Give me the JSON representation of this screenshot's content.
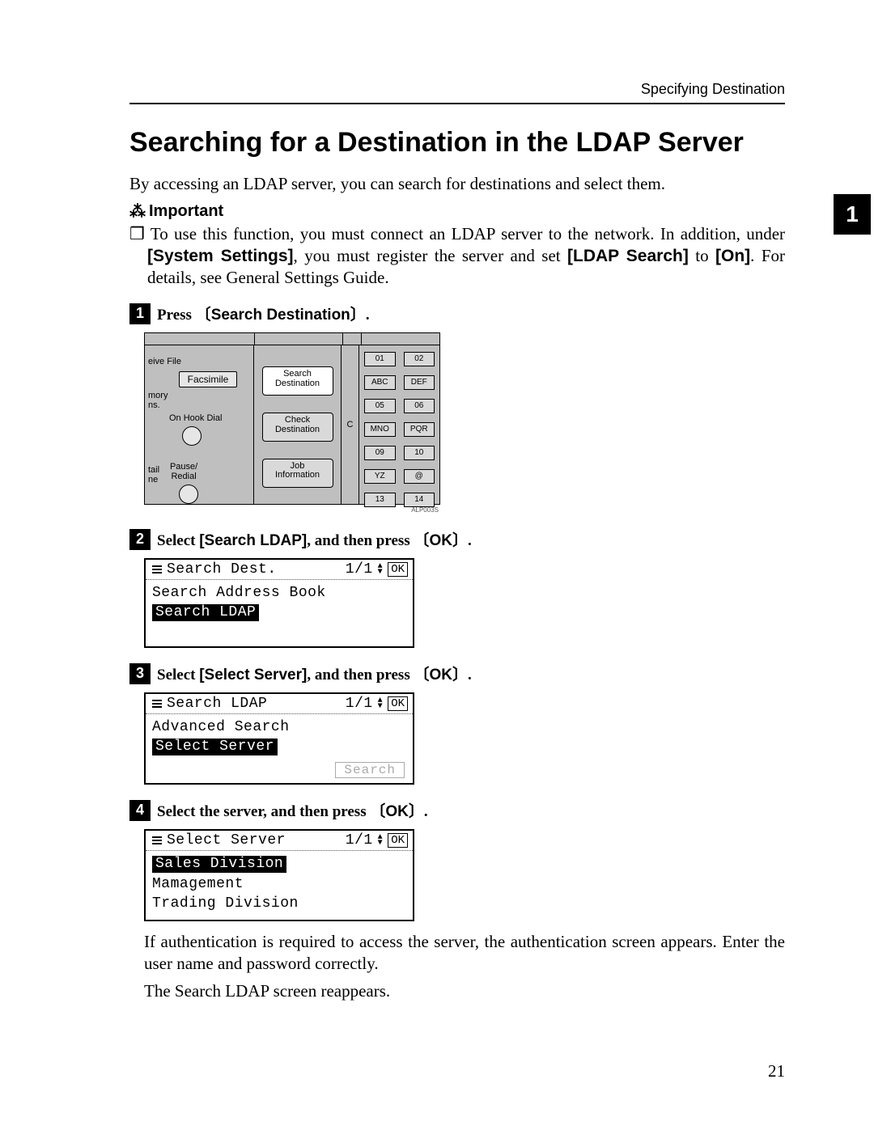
{
  "header": {
    "running": "Specifying Destination"
  },
  "chapter_tab": "1",
  "title": "Searching for a Destination in the LDAP Server",
  "intro": "By accessing an LDAP server, you can search for destinations and select them.",
  "important": {
    "label": "Important",
    "bullet": "❒",
    "note_before": "To use this function, you must connect an LDAP server to the network. In addition, under ",
    "system_settings": "[System Settings]",
    "note_mid": ", you must register the server and set ",
    "ldap_search": "[LDAP Search]",
    "note_to": " to ",
    "on": "[On]",
    "note_after": ". For details, see General Settings Guide."
  },
  "steps": {
    "s1": {
      "num": "1",
      "press": "Press",
      "btn": "Search Destination",
      "dot": "."
    },
    "s2": {
      "num": "2",
      "select": "Select ",
      "search_ldap": "[Search LDAP]",
      "then": ", and then press ",
      "ok": "OK",
      "dot": "."
    },
    "s3": {
      "num": "3",
      "select": "Select ",
      "select_server": "[Select Server]",
      "then": ", and then press ",
      "ok": "OK",
      "dot": "."
    },
    "s4": {
      "num": "4",
      "text": "Select the server, and then press ",
      "ok": "OK",
      "dot": "."
    }
  },
  "panel": {
    "left": {
      "eive_file": "eive File",
      "facsimile": "Facsimile",
      "mory_ns": "mory\nns.",
      "on_hook": "On Hook Dial",
      "tail_ne": "tail\nne",
      "pause_redial": "Pause/\nRedial"
    },
    "mid": {
      "search_dest": "Search\nDestination",
      "check_dest": "Check\nDestination",
      "job_info": "Job\nInformation"
    },
    "thin": {
      "cg": "C"
    },
    "keypad": [
      [
        "01",
        "02"
      ],
      [
        "ABC",
        "DEF"
      ],
      [
        "05",
        "06"
      ],
      [
        "MNO",
        "PQR"
      ],
      [
        "09",
        "10"
      ],
      [
        "YZ",
        "@"
      ],
      [
        "13",
        "14"
      ]
    ],
    "caption": "ALP003S"
  },
  "lcd2": {
    "title": "Search Dest.",
    "page": "1/1",
    "ok": "OK",
    "line1": "Search Address Book",
    "selected": "Search LDAP"
  },
  "lcd3": {
    "title": "Search LDAP",
    "page": "1/1",
    "ok": "OK",
    "line1": "Advanced Search",
    "selected": "Select Server",
    "softkey": "Search"
  },
  "lcd4": {
    "title": "Select Server",
    "page": "1/1",
    "ok": "OK",
    "selected": "Sales Division",
    "line2": "Mamagement",
    "line3": "Trading Division"
  },
  "followup1": "If authentication is required to access the server, the authentication screen appears. Enter the user name and password correctly.",
  "followup2": "The Search LDAP screen reappears.",
  "page_number": "21"
}
